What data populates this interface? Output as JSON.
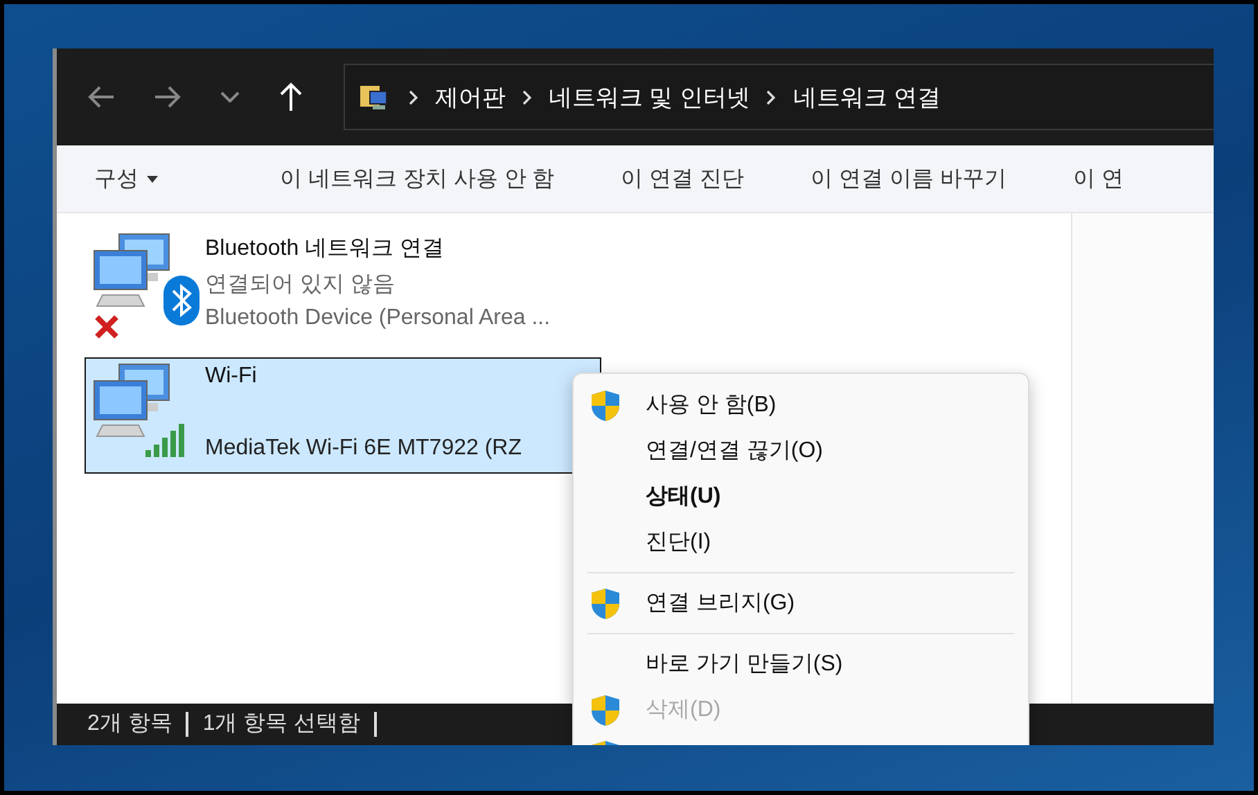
{
  "address_bar": {
    "path": [
      "제어판",
      "네트워크 및 인터넷",
      "네트워크 연결"
    ]
  },
  "command_bar": {
    "items": [
      {
        "label": "구성",
        "dropdown": true
      },
      {
        "label": "이 네트워크 장치 사용 안 함",
        "dropdown": false
      },
      {
        "label": "이 연결 진단",
        "dropdown": false
      },
      {
        "label": "이 연결 이름 바꾸기",
        "dropdown": false
      },
      {
        "label": "이 연",
        "dropdown": false
      }
    ]
  },
  "connections": [
    {
      "kind": "bluetooth",
      "name": "Bluetooth 네트워크 연결",
      "status": "연결되어 있지 않음",
      "device": "Bluetooth Device (Personal Area ...",
      "disconnected": true,
      "selected": false
    },
    {
      "kind": "wifi",
      "name": "Wi-Fi",
      "device": "MediaTek Wi-Fi 6E MT7922 (RZ",
      "disconnected": false,
      "selected": true
    }
  ],
  "context_menu": {
    "items": [
      {
        "kind": "item",
        "label": "사용 안 함(B)",
        "shield": true,
        "bold": false,
        "disabled": false
      },
      {
        "kind": "item",
        "label": "연결/연결 끊기(O)",
        "shield": false,
        "bold": false,
        "disabled": false
      },
      {
        "kind": "item",
        "label": "상태(U)",
        "shield": false,
        "bold": true,
        "disabled": false
      },
      {
        "kind": "item",
        "label": "진단(I)",
        "shield": false,
        "bold": false,
        "disabled": false
      },
      {
        "kind": "separator"
      },
      {
        "kind": "item",
        "label": "연결 브리지(G)",
        "shield": true,
        "bold": false,
        "disabled": false
      },
      {
        "kind": "separator"
      },
      {
        "kind": "item",
        "label": "바로 가기 만들기(S)",
        "shield": false,
        "bold": false,
        "disabled": false
      },
      {
        "kind": "item",
        "label": "삭제(D)",
        "shield": true,
        "bold": false,
        "disabled": true
      },
      {
        "kind": "item",
        "shield": true
      }
    ]
  },
  "status_bar": {
    "items": [
      "2개 항목",
      "1개 항목 선택함"
    ]
  }
}
